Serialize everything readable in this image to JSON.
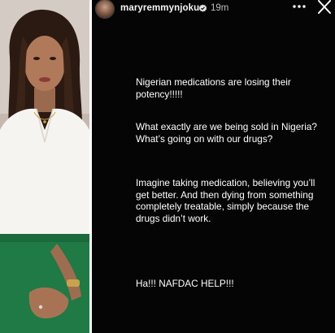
{
  "header": {
    "username": "maryremmynjoku",
    "time_ago": "19m",
    "verified_icon": "verified-badge-icon",
    "more_icon": "more-horizontal-icon",
    "close_icon": "close-icon"
  },
  "story": {
    "paragraphs": [
      "Nigerian medications are losing their potency!!!!!",
      "What exactly are we being sold in Nigeria? What’s going on with our drugs?",
      "Imagine taking medication, believing you’ll get better. And then dying from something completely treatable, simply because the drugs didn’t work.",
      "Ha!!!  NAFDAC HELP!!!"
    ]
  },
  "colors": {
    "story_bg": "#050505",
    "text": "#ffffff",
    "muted": "#bdbdbd",
    "shirt": "#f6f4f1",
    "trousers": "#1f7a45"
  }
}
